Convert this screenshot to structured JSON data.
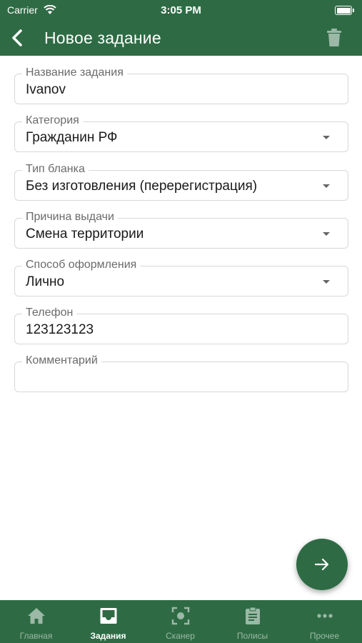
{
  "status_bar": {
    "carrier": "Carrier",
    "time": "3:05 PM"
  },
  "app_bar": {
    "title": "Новое задание"
  },
  "form": {
    "fields": [
      {
        "label": "Название задания",
        "value": "Ivanov",
        "dropdown": false
      },
      {
        "label": "Категория",
        "value": "Гражданин РФ",
        "dropdown": true
      },
      {
        "label": "Тип бланка",
        "value": "Без изготовления (перерегистрация)",
        "dropdown": true
      },
      {
        "label": "Причина выдачи",
        "value": "Смена территории",
        "dropdown": true
      },
      {
        "label": "Способ оформления",
        "value": "Лично",
        "dropdown": true
      },
      {
        "label": "Телефон",
        "value": "123123123",
        "dropdown": false
      },
      {
        "label": "Комментарий",
        "value": "",
        "dropdown": false
      }
    ]
  },
  "tab_bar": {
    "tabs": [
      {
        "label": "Главная",
        "icon": "home-icon",
        "active": false
      },
      {
        "label": "Задания",
        "icon": "inbox-icon",
        "active": true
      },
      {
        "label": "Сканер",
        "icon": "scanner-icon",
        "active": false
      },
      {
        "label": "Полисы",
        "icon": "clipboard-icon",
        "active": false
      },
      {
        "label": "Прочее",
        "icon": "more-icon",
        "active": false
      }
    ]
  },
  "colors": {
    "primary": "#2e6b44",
    "tab_inactive": "#9cb8a6",
    "field_border": "#d8d8d8"
  }
}
